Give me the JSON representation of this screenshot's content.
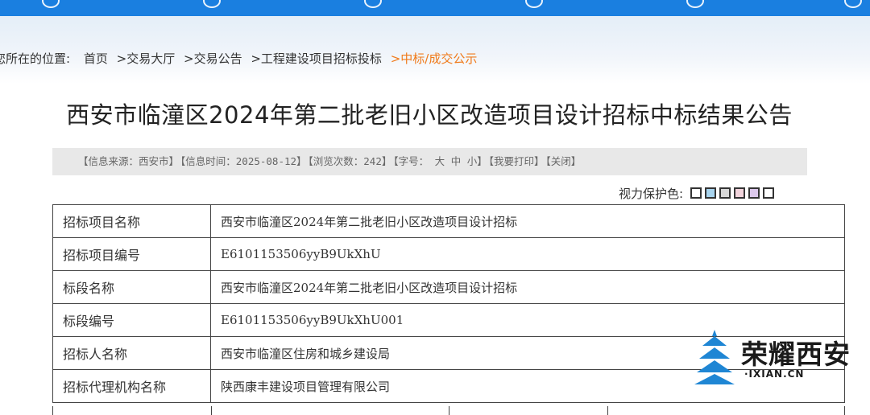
{
  "breadcrumb": {
    "prefix": "您所在的位置:",
    "items": [
      "首页",
      ">交易大厅",
      ">交易公告",
      ">工程建设项目招标投标",
      ">中标/成交公示"
    ]
  },
  "title": "西安市临潼区2024年第二批老旧小区改造项目设计招标中标结果公告",
  "info_bar": {
    "source": "【信息来源：西安市】",
    "time": "【信息时间：2025-08-12】",
    "views": "【浏览次数：242】",
    "font_size_label": "【字号：",
    "size_large": "大",
    "size_medium": "中",
    "size_small": "小",
    "font_size_close": "】",
    "print": "【我要打印】",
    "close": "【关闭】"
  },
  "vision": {
    "label": "视力保护色:",
    "swatches": [
      "#ffffff",
      "#a8d4ee",
      "#d8d8d8",
      "#f2d4dc",
      "#dcc8ec",
      "#ffffff"
    ]
  },
  "table": {
    "rows": [
      {
        "label": "招标项目名称",
        "value": "西安市临潼区2024年第二批老旧小区改造项目设计招标"
      },
      {
        "label": "招标项目编号",
        "value": "E6101153506yyB9UkXhU"
      },
      {
        "label": "标段名称",
        "value": "西安市临潼区2024年第二批老旧小区改造项目设计招标"
      },
      {
        "label": "标段编号",
        "value": "E6101153506yyB9UkXhU001"
      },
      {
        "label": "招标人名称",
        "value": "西安市临潼区住房和城乡建设局"
      },
      {
        "label": "招标代理机构名称",
        "value": "陕西康丰建设项目管理有限公司"
      }
    ]
  },
  "watermark": {
    "text": "荣耀西安",
    "url": "·IXIAN.CN"
  },
  "colors": {
    "topbar": "#1a7fe0",
    "breadcrumb_current": "#f07a1a",
    "watermark_blue": "#1f86d4"
  }
}
